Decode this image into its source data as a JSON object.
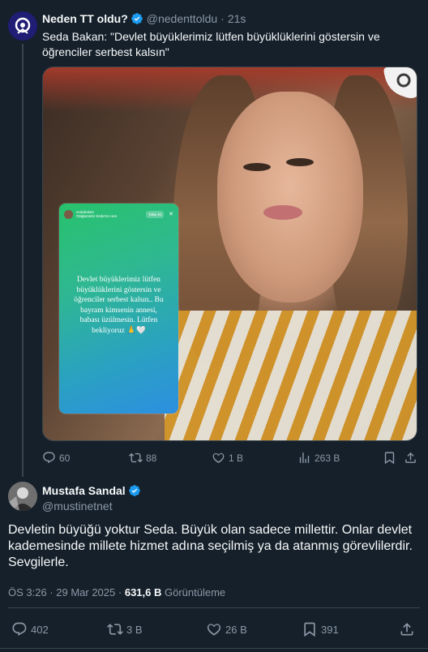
{
  "quoted": {
    "name": "Neden TT oldu?",
    "handle": "@nedenttoldu",
    "separator": "·",
    "time": "21s",
    "text": "Seda Bakan: \"Devlet büyüklerimiz lütfen büyüklüklerini göstersin ve öğrenciler serbest kalsın\"",
    "story": {
      "username": "sedabakan",
      "subline": "Olağanüstü Seda'nın ses",
      "follow_label": "Takip Et",
      "close_glyph": "✕",
      "message": "Devlet büyüklerimiz lütfen büyüklüklerini göstersin ve öğrenciler serbest kalsın.. Bu bayram kimsenin annesi, babası üzülmesin. Lütfen bekliyoruz 🙏🤍"
    },
    "stats": {
      "replies": "60",
      "retweets": "88",
      "likes": "1 B",
      "views": "263 B"
    }
  },
  "main": {
    "name": "Mustafa Sandal",
    "handle": "@mustinetnet",
    "text": "Devletin büyüğü yoktur Seda. Büyük olan sadece millettir. Onlar devlet kademesinde millete hizmet adına seçilmiş ya da atanmış görevlilerdir. Sevgilerle.",
    "timestamp": "ÖS 3:26 · 29 Mar 2025",
    "dot": "·",
    "views_count": "631,6 B",
    "views_label": "Görüntüleme",
    "stats": {
      "replies": "402",
      "retweets": "3 B",
      "likes": "26 B",
      "bookmarks": "391"
    }
  },
  "colors": {
    "background": "#15202b",
    "verified": "#1d9bf0",
    "muted": "#8b98a5",
    "text": "#f7f9f9"
  },
  "icons": [
    "reply-icon",
    "retweet-icon",
    "like-icon",
    "views-icon",
    "bookmark-icon",
    "share-icon",
    "verified-badge-icon"
  ]
}
